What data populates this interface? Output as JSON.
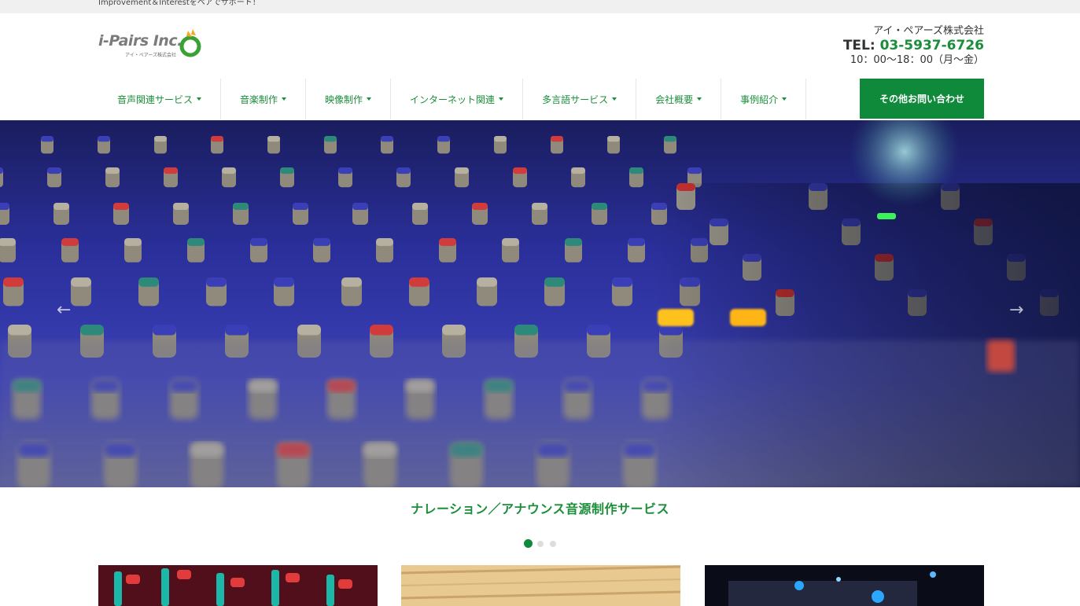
{
  "topbar": {
    "tagline": "Improvement＆Interestをペアでサポート！"
  },
  "header": {
    "logo_text": "i-Pairs Inc.",
    "logo_sub": "アイ・ペアーズ株式会社",
    "company": "アイ・ペアーズ株式会社",
    "tel_label": "TEL: ",
    "tel_number": "03-5937-6726",
    "hours": "10：00〜18：00（月〜金）"
  },
  "nav": {
    "items": [
      {
        "label": "音声関連サービス"
      },
      {
        "label": "音楽制作"
      },
      {
        "label": "映像制作"
      },
      {
        "label": "インターネット関連"
      },
      {
        "label": "多言語サービス"
      },
      {
        "label": "会社概要"
      },
      {
        "label": "事例紹介"
      }
    ],
    "cta": "その他お問い合わせ"
  },
  "hero": {
    "prev_icon": "arrow-left-icon",
    "next_icon": "arrow-right-icon",
    "prev_glyph": "←",
    "next_glyph": "→",
    "caption": "ナレーション／アナウンス音源制作サービス",
    "slide_count": 3,
    "active_slide": 1
  },
  "colors": {
    "brand_green": "#1b8e3a",
    "cta_green": "#0e8a3a"
  }
}
